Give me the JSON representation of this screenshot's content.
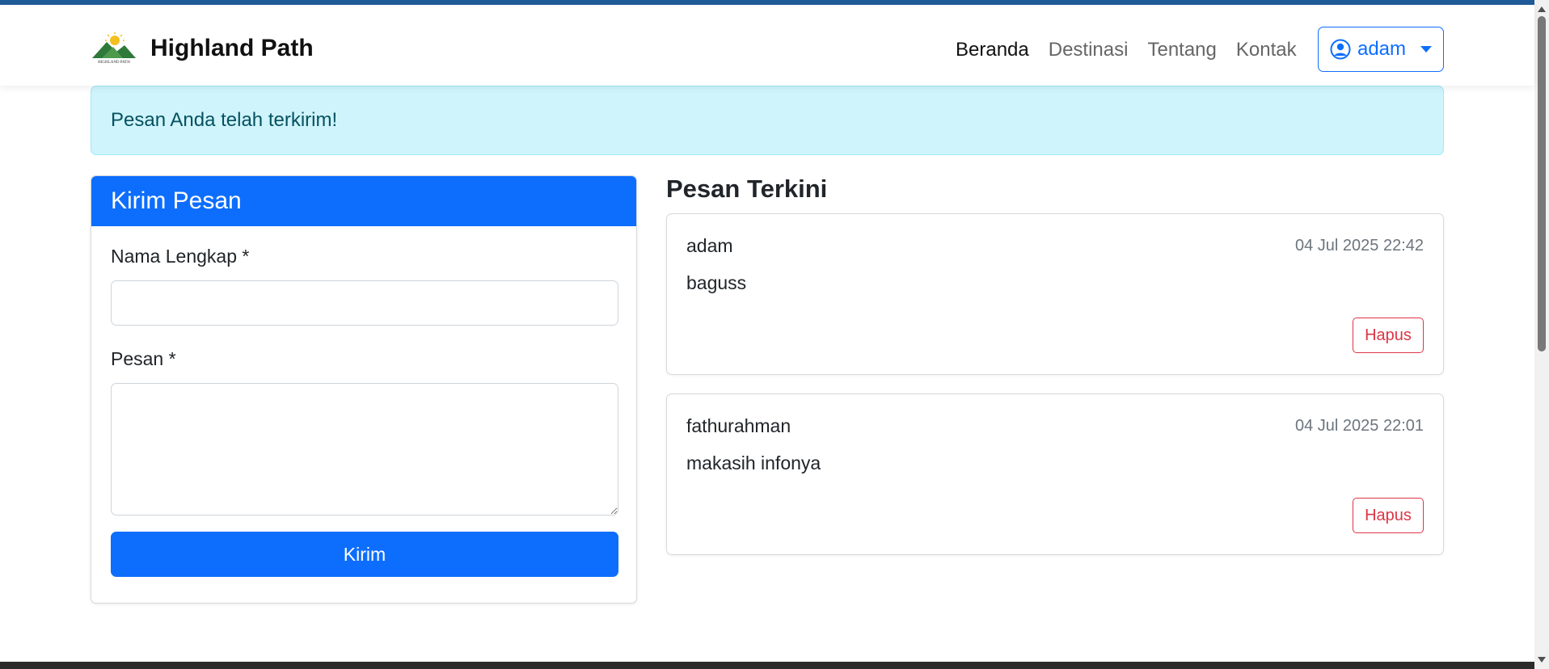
{
  "brand": {
    "name": "Highland Path",
    "logo_text": "HIGHLAND PATH"
  },
  "nav": {
    "items": [
      {
        "label": "Beranda",
        "active": true
      },
      {
        "label": "Destinasi",
        "active": false
      },
      {
        "label": "Tentang",
        "active": false
      },
      {
        "label": "Kontak",
        "active": false
      }
    ],
    "user": {
      "name": "adam",
      "icon": "user-circle-icon"
    }
  },
  "alert": {
    "text": "Pesan Anda telah terkirim!"
  },
  "form": {
    "title": "Kirim Pesan",
    "name_label": "Nama Lengkap *",
    "name_value": "",
    "message_label": "Pesan *",
    "message_value": "",
    "submit_label": "Kirim"
  },
  "messages": {
    "title": "Pesan Terkini",
    "items": [
      {
        "name": "adam",
        "time": "04 Jul 2025 22:42",
        "text": "baguss",
        "delete_label": "Hapus"
      },
      {
        "name": "fathurahman",
        "time": "04 Jul 2025 22:01",
        "text": "makasih infonya",
        "delete_label": "Hapus"
      }
    ]
  },
  "colors": {
    "primary": "#0d6efd",
    "danger": "#dc3545",
    "alert_bg": "#cff4fc",
    "alert_text": "#055160",
    "top_bar": "#1f5b9a"
  }
}
